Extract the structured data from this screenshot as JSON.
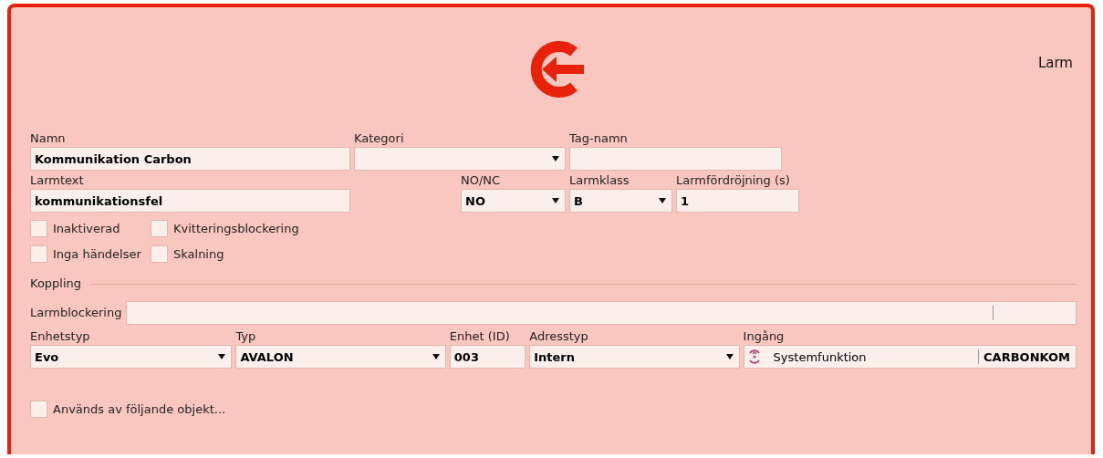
{
  "header": {
    "title": "Larm"
  },
  "row_1": [
    {
      "kind": "text",
      "label": "Namn",
      "value": "Kommunikation Carbon"
    },
    {
      "kind": "select",
      "label": "Kategori"
    },
    {
      "kind": "text",
      "label": "Tag-namn"
    }
  ],
  "row_2": [
    {
      "kind": "text",
      "label": "Larmtext",
      "value": "kommunikationsfel"
    },
    {
      "kind": "select",
      "label": "NO/NC",
      "value": "NO"
    },
    {
      "kind": "select",
      "label": "Larmklass",
      "value": "B"
    },
    {
      "kind": "text",
      "label": "Larmfördröjning (s)",
      "value": "1"
    }
  ],
  "checkboxes": [
    {
      "label": "Inaktiverad",
      "checked": false
    },
    {
      "label": "Kvitteringsblockering",
      "checked": false
    },
    {
      "label": "Inga händelser",
      "checked": false
    },
    {
      "label": "Skalning",
      "checked": false
    }
  ],
  "section": {
    "title": "Koppling"
  },
  "larmblockering": {
    "label": "Larmblockering"
  },
  "row_3": [
    {
      "kind": "select",
      "label": "Enhetstyp",
      "value": "Evo"
    },
    {
      "kind": "select",
      "label": "Typ",
      "value": "AVALON"
    },
    {
      "kind": "text",
      "label": "Enhet (ID)",
      "value": "003"
    },
    {
      "kind": "select",
      "label": "Adresstyp",
      "value": "Intern"
    },
    {
      "kind": "input",
      "label": "Ingång",
      "value": "Systemfunktion",
      "code": "CARBONKOM"
    }
  ],
  "footer_checkbox": {
    "label": "Används av följande objekt...",
    "checked": false
  }
}
